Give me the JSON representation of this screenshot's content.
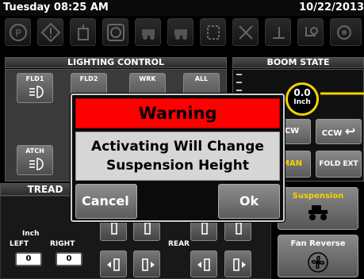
{
  "status": {
    "day_time": "Tuesday 08:25 AM",
    "date": "10/22/2013"
  },
  "icons": [
    "parking-brake-icon",
    "warning-icon",
    "fuel-filter-icon",
    "hydraulic-icon",
    "tractor-icon",
    "tractor-icon",
    "heater-icon",
    "fan-icon",
    "seat-icon",
    "steering-icon",
    "gear-icon"
  ],
  "sections": {
    "lighting": "LIGHTING CONTROL",
    "boom": "BOOM STATE",
    "tread": "TREAD"
  },
  "lights": {
    "fld1": "FLD1",
    "fld2": "FLD2",
    "wrk": "WRK",
    "all": "ALL",
    "atch": "ATCH"
  },
  "boom": {
    "value": "0.0",
    "unit": "Inch",
    "cw": "CW",
    "ccw": "CCW",
    "man": "MAN",
    "fold_ext": "FOLD EXT"
  },
  "tread": {
    "unit": "Inch",
    "left_label": "LEFT",
    "right_label": "RIGHT",
    "rear_label": "REAR",
    "left_value": "0",
    "right_value": "0"
  },
  "side": {
    "suspension": "Suspension",
    "fan_reverse": "Fan Reverse"
  },
  "dialog": {
    "title": "Warning",
    "line1": "Activating Will Change",
    "line2": "Suspension Height",
    "cancel": "Cancel",
    "ok": "Ok"
  },
  "colors": {
    "warning_red": "#ff0000",
    "accent_yellow": "#f4d300"
  }
}
